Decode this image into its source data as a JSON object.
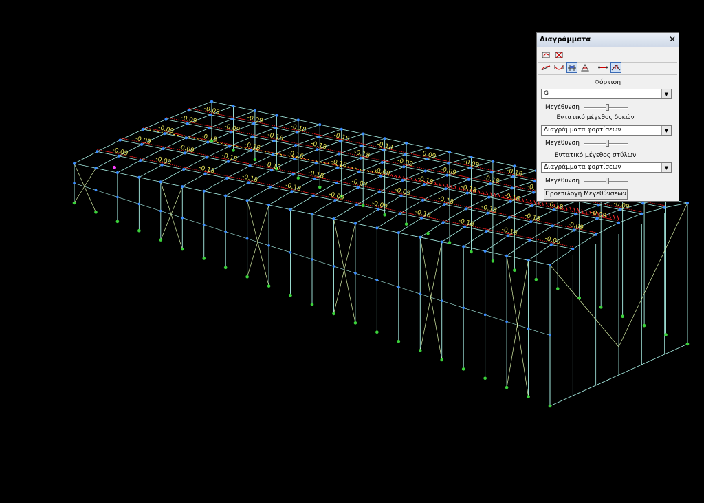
{
  "panel": {
    "title": "Διαγράμματα",
    "close_glyph": "✕",
    "toolbar_icons_row1": [
      "diagram-on-icon",
      "diagram-off-icon"
    ],
    "toolbar_icons_row2": [
      "moment-icon",
      "shear-icon",
      "axial-icon",
      "torsion-icon",
      "member-icon",
      "load-diagram-icon"
    ],
    "load_label": "Φόρτιση",
    "load_value": "G",
    "zoom_label": "Μεγέθυνση",
    "beam_label": "Εντατικό μέγεθος δοκών",
    "beam_value": "Διαγράμματα φορτίσεων",
    "column_label": "Εντατικό μέγεθος στύλων",
    "column_value": "Διαγράμματα φορτίσεων",
    "zoom_levels": [
      0.55,
      0.55,
      0.55
    ],
    "reset_button": "Προεπιλογή Μεγεθύνσεων",
    "dropdown_glyph": "▼"
  },
  "diagram": {
    "labels_near": [
      "-0.09",
      "-0.18",
      "-0.18",
      "-0.18",
      "-0.09"
    ],
    "labels_far": [
      "-0.09",
      "-0.18",
      "-0.18",
      "-0.18",
      "-0.09"
    ],
    "labels_ridge": [
      "-0.09",
      "-0.18",
      "-0.16",
      "-0.18",
      "-0.18"
    ],
    "colors": {
      "background": "#000000",
      "frame": "#a9f0e6",
      "node": "#3a8cff",
      "support": "#3bd13b",
      "load_line": "#ff2020",
      "label": "#e8e35a",
      "highlight": "#ff40ff"
    }
  }
}
